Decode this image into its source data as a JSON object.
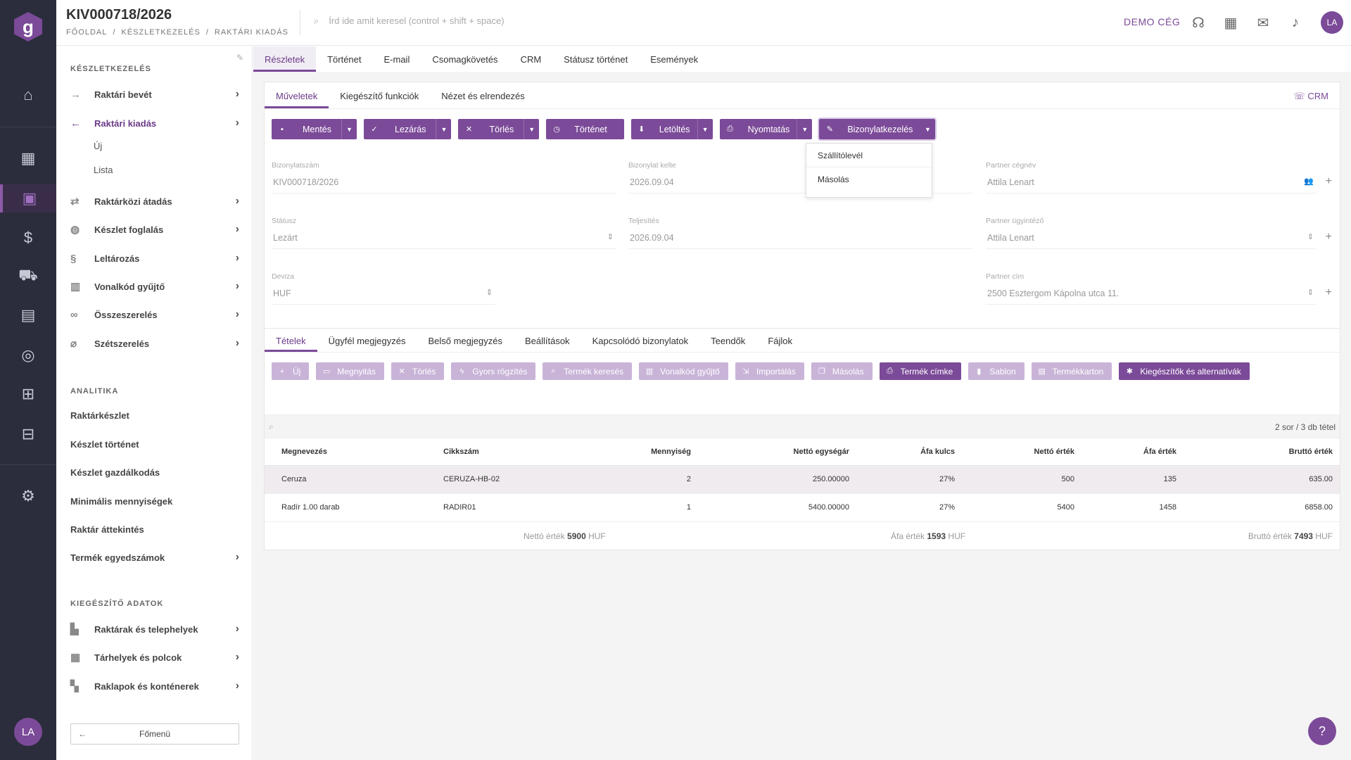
{
  "header": {
    "title": "KIV000718/2026",
    "breadcrumb": [
      "FŐOLDAL",
      "/",
      "KÉSZLETKEZELÉS",
      "/",
      "RAKTÁRI KIADÁS"
    ],
    "search_placeholder": "Írd ide amit keresel (control + shift + space)",
    "company": "DEMO CÉG",
    "user_initials": "LA"
  },
  "sidebar": {
    "section1": "KÉSZLETKEZELÉS",
    "items1": [
      {
        "label": "Raktári bevét",
        "icon": "arrow-right-icon"
      },
      {
        "label": "Raktári kiadás",
        "icon": "arrow-left-icon"
      },
      {
        "label": "Raktárközi átadás",
        "icon": "swap-icon"
      },
      {
        "label": "Készlet foglalás",
        "icon": "reserve-icon"
      },
      {
        "label": "Leltározás",
        "icon": "inventory-icon"
      },
      {
        "label": "Vonalkód gyűjtő",
        "icon": "barcode-icon"
      },
      {
        "label": "Összeszerelés",
        "icon": "link-icon"
      },
      {
        "label": "Szétszerelés",
        "icon": "unlink-icon"
      }
    ],
    "subitems": [
      "Új",
      "Lista"
    ],
    "section2": "ANALITIKA",
    "items2": [
      "Raktárkészlet",
      "Készlet történet",
      "Készlet gazdálkodás",
      "Minimális mennyiségek",
      "Raktár áttekintés",
      "Termék egyedszámok"
    ],
    "section3": "KIEGÉSZÍTŐ ADATOK",
    "items3": [
      "Raktárak és telephelyek",
      "Tárhelyek és polcok",
      "Raklapok és konténerek"
    ],
    "main_menu": "Főmenü"
  },
  "tabs_top": [
    "Részletek",
    "Történet",
    "E-mail",
    "Csomagkövetés",
    "CRM",
    "Státusz történet",
    "Események"
  ],
  "tabs_ops": [
    "Műveletek",
    "Kiegészítő funkciók",
    "Nézet és elrendezés"
  ],
  "crm_link": "CRM",
  "toolbar": {
    "save": "Mentés",
    "close": "Lezárás",
    "delete": "Törlés",
    "history": "Történet",
    "download": "Letöltés",
    "print": "Nyomtatás",
    "docs": "Bizonylatkezelés"
  },
  "docs_menu": [
    "Szállítólevél",
    "Másolás"
  ],
  "form": {
    "doc_no_label": "Bizonylatszám",
    "doc_no": "KIV000718/2026",
    "date_label": "Bizonylat kelte",
    "date": "2026.09.04",
    "partner_label": "Partner cégnév",
    "partner": "Attila Lenart",
    "status_label": "Státusz",
    "status": "Lezárt",
    "fulfil_label": "Teljesítés",
    "fulfil": "2026.09.04",
    "agent_label": "Partner ügyintéző",
    "agent": "Attila Lenart",
    "currency_label": "Deviza",
    "currency": "HUF",
    "address_label": "Partner cím",
    "address": "2500 Esztergom Kápolna utca 11."
  },
  "tabs_items": [
    "Tételek",
    "Ügyfél megjegyzés",
    "Belső megjegyzés",
    "Beállítások",
    "Kapcsolódó bizonylatok",
    "Teendők",
    "Fájlok"
  ],
  "item_buttons": [
    "Új",
    "Megnyitás",
    "Törlés",
    "Gyors rögzítés",
    "Termék keresés",
    "Vonalkód gyűjtő",
    "Importálás",
    "Másolás",
    "Termék címke",
    "Sablon",
    "Termékkarton",
    "Kiegészítők és alternatívák"
  ],
  "row_count": "2 sor / 3 db tétel",
  "table": {
    "headers": [
      "Megnevezés",
      "Cikkszám",
      "Mennyiség",
      "Nettó egységár",
      "Áfa kulcs",
      "Nettó érték",
      "Áfa érték",
      "Bruttó érték"
    ],
    "rows": [
      [
        "Ceruza",
        "CERUZA-HB-02",
        "2",
        "250.00000",
        "27%",
        "500",
        "135",
        "635.00"
      ],
      [
        "Radír 1.00 darab",
        "RADIR01",
        "1",
        "5400.00000",
        "27%",
        "5400",
        "1458",
        "6858.00"
      ]
    ]
  },
  "totals": {
    "net_label": "Nettó érték",
    "net": "5900",
    "vat_label": "Áfa érték",
    "vat": "1593",
    "gross_label": "Bruttó érték",
    "gross": "7493",
    "currency": "HUF"
  },
  "help": "?"
}
